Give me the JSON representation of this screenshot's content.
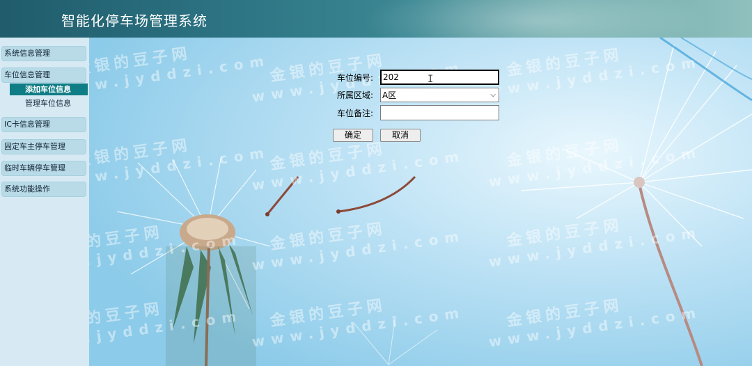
{
  "header": {
    "title": "智能化停车场管理系统"
  },
  "sidebar": {
    "groups": [
      {
        "label": "系统信息管理"
      },
      {
        "label": "车位信息管理"
      },
      {
        "label": "IC卡信息管理"
      },
      {
        "label": "固定车主停车管理"
      },
      {
        "label": "临时车辆停车管理"
      },
      {
        "label": "系统功能操作"
      }
    ],
    "parking_submenu": [
      {
        "label": "添加车位信息",
        "active": true
      },
      {
        "label": "管理车位信息",
        "active": false
      }
    ]
  },
  "form": {
    "space_no": {
      "label": "车位编号:",
      "value": "202"
    },
    "area": {
      "label": "所属区域:",
      "selected": "A区"
    },
    "remark": {
      "label": "车位备注:",
      "value": ""
    },
    "confirm_label": "确定",
    "cancel_label": "取消"
  },
  "watermark": {
    "line1": "金银的豆子网",
    "line2": "www.jyddzi.com"
  }
}
